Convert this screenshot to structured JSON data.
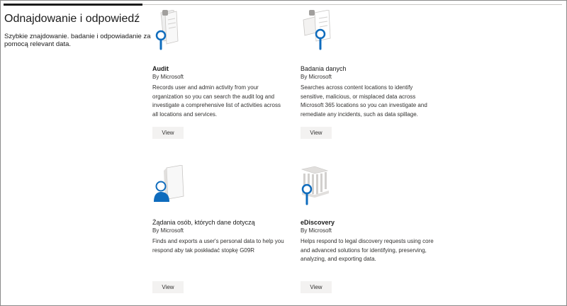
{
  "header": {
    "title": "Odnajdowanie i odpowiedź",
    "subtitle": "Szybkie znajdowanie. badanie i odpowiadanie za pomocą relevant data."
  },
  "cards": [
    {
      "title": "Audit",
      "publisher": "By Microsoft",
      "description": "Records user and admin activity from your organization so you can search the audit log and investigate a comprehensive list of activities across all locations and services.",
      "button": "View",
      "icon": "audit-document-magnifier-icon"
    },
    {
      "title": "Badania danych",
      "publisher": "By Microsoft",
      "description": "Searches across content locations to identify sensitive, malicious, or misplaced data across Microsoft 365 locations so you can investigate and remediate any incidents, such as data spillage.",
      "button": "View",
      "icon": "data-investigation-magnifier-icon"
    },
    {
      "title": "Żądania osób, których dane dotyczą",
      "publisher": "By Microsoft",
      "description": "Finds and exports a user's personal data to help you respond aby tak poskładać stopkę G09R",
      "button": "View",
      "icon": "person-document-icon"
    },
    {
      "title": "eDiscovery",
      "publisher": "By Microsoft",
      "description": "Helps respond to legal discovery requests using core and advanced solutions for identifying, preserving, analyzing, and exporting data.",
      "button": "View",
      "icon": "courthouse-magnifier-icon"
    }
  ],
  "colors": {
    "accent": "#0f6cbd",
    "illustration_gray": "#d2d0ce",
    "button_bg": "#f3f2f1"
  }
}
